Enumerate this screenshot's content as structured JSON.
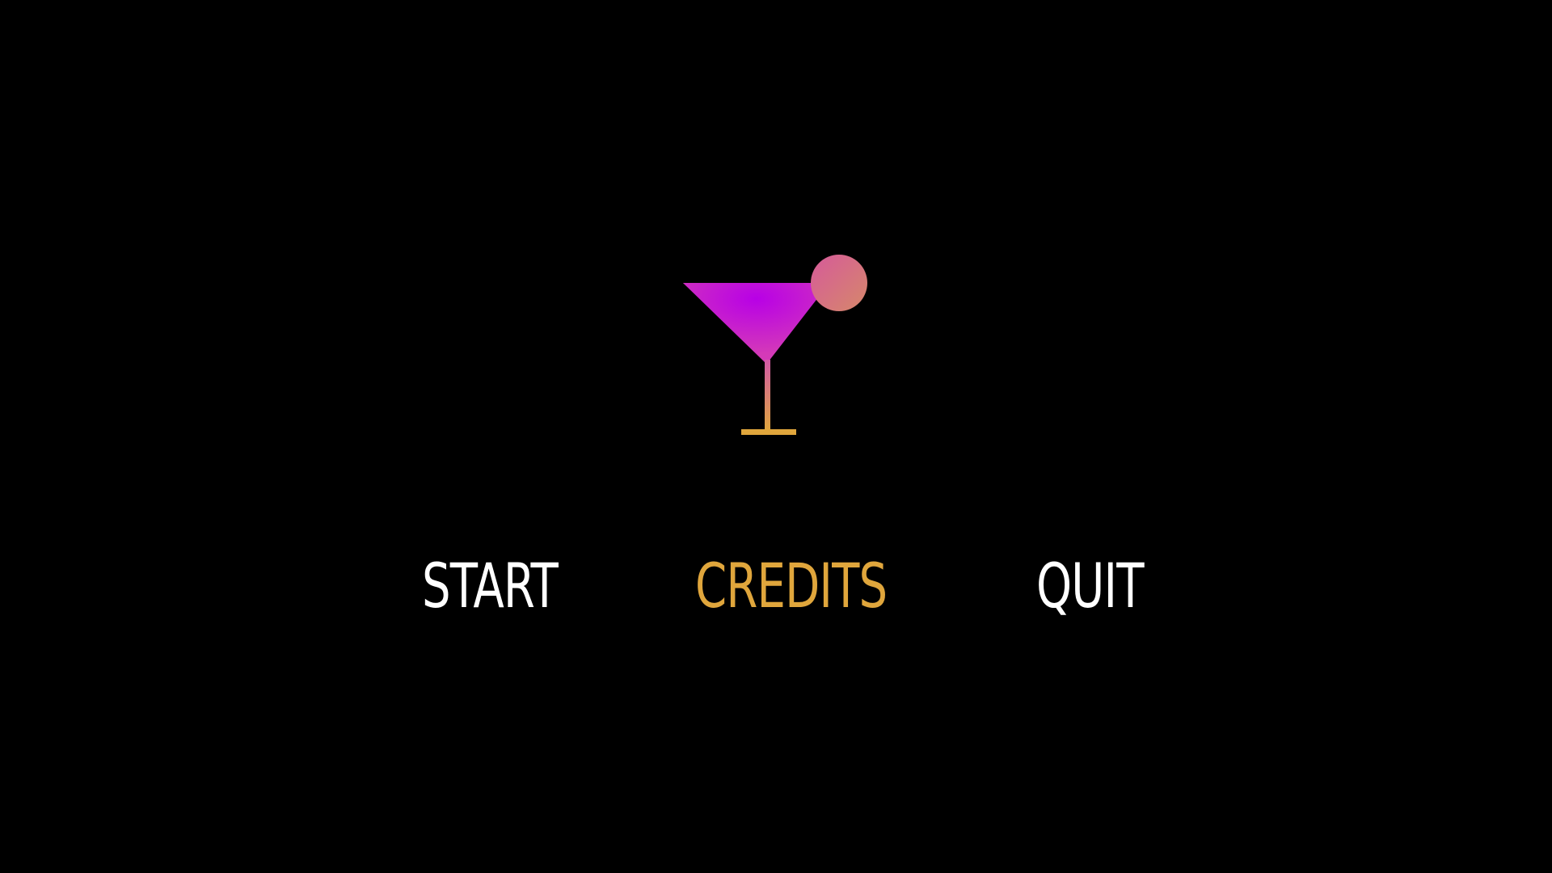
{
  "logo": {
    "icon": "cocktail-glass-icon",
    "colors": {
      "gradient_top": "#b800e6",
      "gradient_bottom": "#e0a63c",
      "garnish": "#d6707a"
    }
  },
  "menu": {
    "items": [
      {
        "id": "start",
        "label": "START",
        "selected": false
      },
      {
        "id": "credits",
        "label": "CREDITS",
        "selected": true
      },
      {
        "id": "quit",
        "label": "QUIT",
        "selected": false
      }
    ]
  },
  "colors": {
    "background": "#000000",
    "menu_default": "#ffffff",
    "menu_selected": "#e0a63c"
  }
}
